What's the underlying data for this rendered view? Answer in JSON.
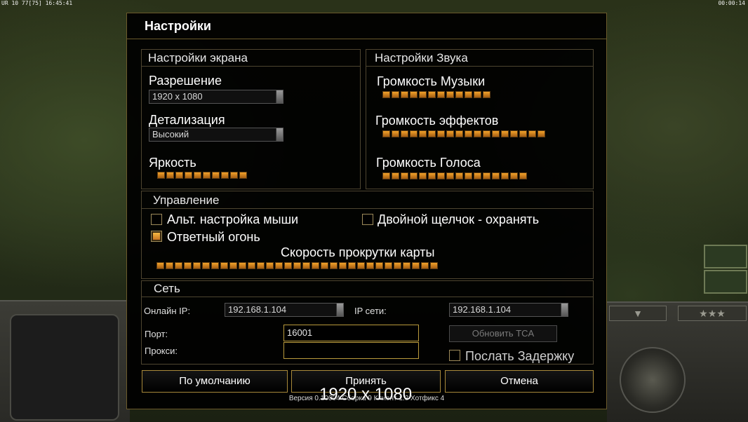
{
  "topbar": {
    "left_status": "UR 10 77[75] 16:45:41",
    "right_time": "00:00:14"
  },
  "dialog": {
    "title": "Настройки",
    "screen": {
      "title": "Настройки экрана",
      "resolution_label": "Разрешение",
      "resolution_value": "1920 x 1080",
      "detail_label": "Детализация",
      "detail_value": "Высокий",
      "brightness_label": "Яркость",
      "brightness_level": 10
    },
    "sound": {
      "title": "Настройки Звука",
      "music_label": "Громкость Музыки",
      "music_level": 12,
      "effects_label": "Громкость эффектов",
      "effects_level": 18,
      "voice_label": "Громкость Голоса",
      "voice_level": 16
    },
    "controls": {
      "title": "Управление",
      "alt_mouse_label": "Альт. настройка мыши",
      "alt_mouse_checked": false,
      "double_click_label": "Двойной щелчок - охранять",
      "double_click_checked": false,
      "return_fire_label": "Ответный огонь",
      "return_fire_checked": true,
      "scroll_speed_label": "Скорость прокрутки карты",
      "scroll_speed_level": 31
    },
    "network": {
      "title": "Сеть",
      "online_ip_label": "Онлайн IP:",
      "online_ip_value": "192.168.1.104",
      "lan_ip_label": "IP сети:",
      "lan_ip_value": "192.168.1.104",
      "port_label": "Порт:",
      "port_value": "16001",
      "proxy_label": "Прокси:",
      "proxy_value": "",
      "update_tca_label": "Обновить TCA",
      "send_delay_label": "Послать Задержку",
      "send_delay_checked": false
    },
    "buttons": {
      "defaults": "По умолчанию",
      "accept": "Принять",
      "cancel": "Отмена"
    },
    "version": "Версия 0.10004 Сборка 9 Клиент 1.3 Хотфикс 4"
  },
  "overlay_resolution": "1920 x 1080",
  "colors": {
    "accent_gold": "#b99a3c",
    "slider_orange": "#f2a22a",
    "dialog_bg": "#000000"
  }
}
